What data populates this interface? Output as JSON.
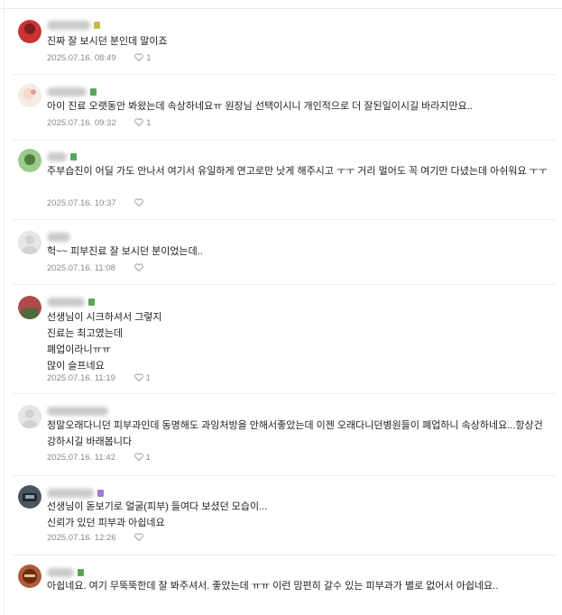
{
  "comments": [
    {
      "text": "진짜 잘 보시던 분인데 말이죠",
      "date": "2025.07.16. 08:49",
      "likes": "1",
      "badge_color": "#c9b94a",
      "avatar_colors": [
        "#c33",
        "#7a1e1e"
      ]
    },
    {
      "text": "아이 진료 오랫동안 봐왔는데 속상하네요ㅠ 원장님 선택이시니 개인적으로 더 잘된일이시길 바라지만요..",
      "date": "2025.07.16. 09:32",
      "likes": "1",
      "badge_color": "#5aa55a",
      "avatar_colors": [
        "#f2e6d8",
        "#e0a0a0"
      ]
    },
    {
      "text": "주부습진이 어딜 가도 안나서 여기서 유일하게 연고로만 낫게 해주시고 ㅜㅜ 거리 멀어도 꼭 여기만 다녔는데 아쉬워요 ㅜㅜ",
      "date": "2025.07.16. 10:37",
      "likes": "",
      "badge_color": "#5aa55a",
      "avatar_colors": [
        "#9acb8a",
        "#4f7d3c"
      ]
    },
    {
      "text": "헉~~ 피부진료 잘 보시던 분이었는데..",
      "date": "2025.07.16. 11:08",
      "likes": "",
      "badge_color": "",
      "avatar_colors": [
        "#e6e6e6",
        "#d2d2d2"
      ]
    },
    {
      "text": "선생님이 시크하셔서 그렇지\n진료는 최고였는데\n폐업이라니ㅠㅠ\n많이 슬프네요",
      "date": "2025.07.16. 11:19",
      "likes": "1",
      "badge_color": "#5aa55a",
      "avatar_colors": [
        "#b04a4a",
        "#4a6b3a"
      ]
    },
    {
      "text": "정말오래다니던 피부과인데 동명해도 과잉처방을 안해서좋았는데 이젠 오래다니던병원들이 폐업하니 속상하네요...항상건강하시길 바래봅니다",
      "date": "2025.07.16. 11:42",
      "likes": "1",
      "badge_color": "",
      "avatar_colors": [
        "#e6e6e6",
        "#d2d2d2"
      ]
    },
    {
      "text": "선생님이 돋보기로 얼굴(피부) 들여다 보셨던 모습이...\n신뢰가 있던 피부과 아쉽네요",
      "date": "2025.07.16. 12:26",
      "likes": "",
      "badge_color": "#a07cc8",
      "avatar_colors": [
        "#4a5560",
        "#1f262c"
      ]
    },
    {
      "text": "아쉽네요. 여기 무뚝뚝한데 잘 봐주셔서. 좋았는데 ㅠㅠ 이런 맘편히 갈수 있는 피부과가 별로 없어서 아쉽네요..",
      "date": "",
      "likes": "",
      "badge_color": "#5aa55a",
      "avatar_colors": [
        "#b05a3a",
        "#6b2a14"
      ]
    }
  ]
}
